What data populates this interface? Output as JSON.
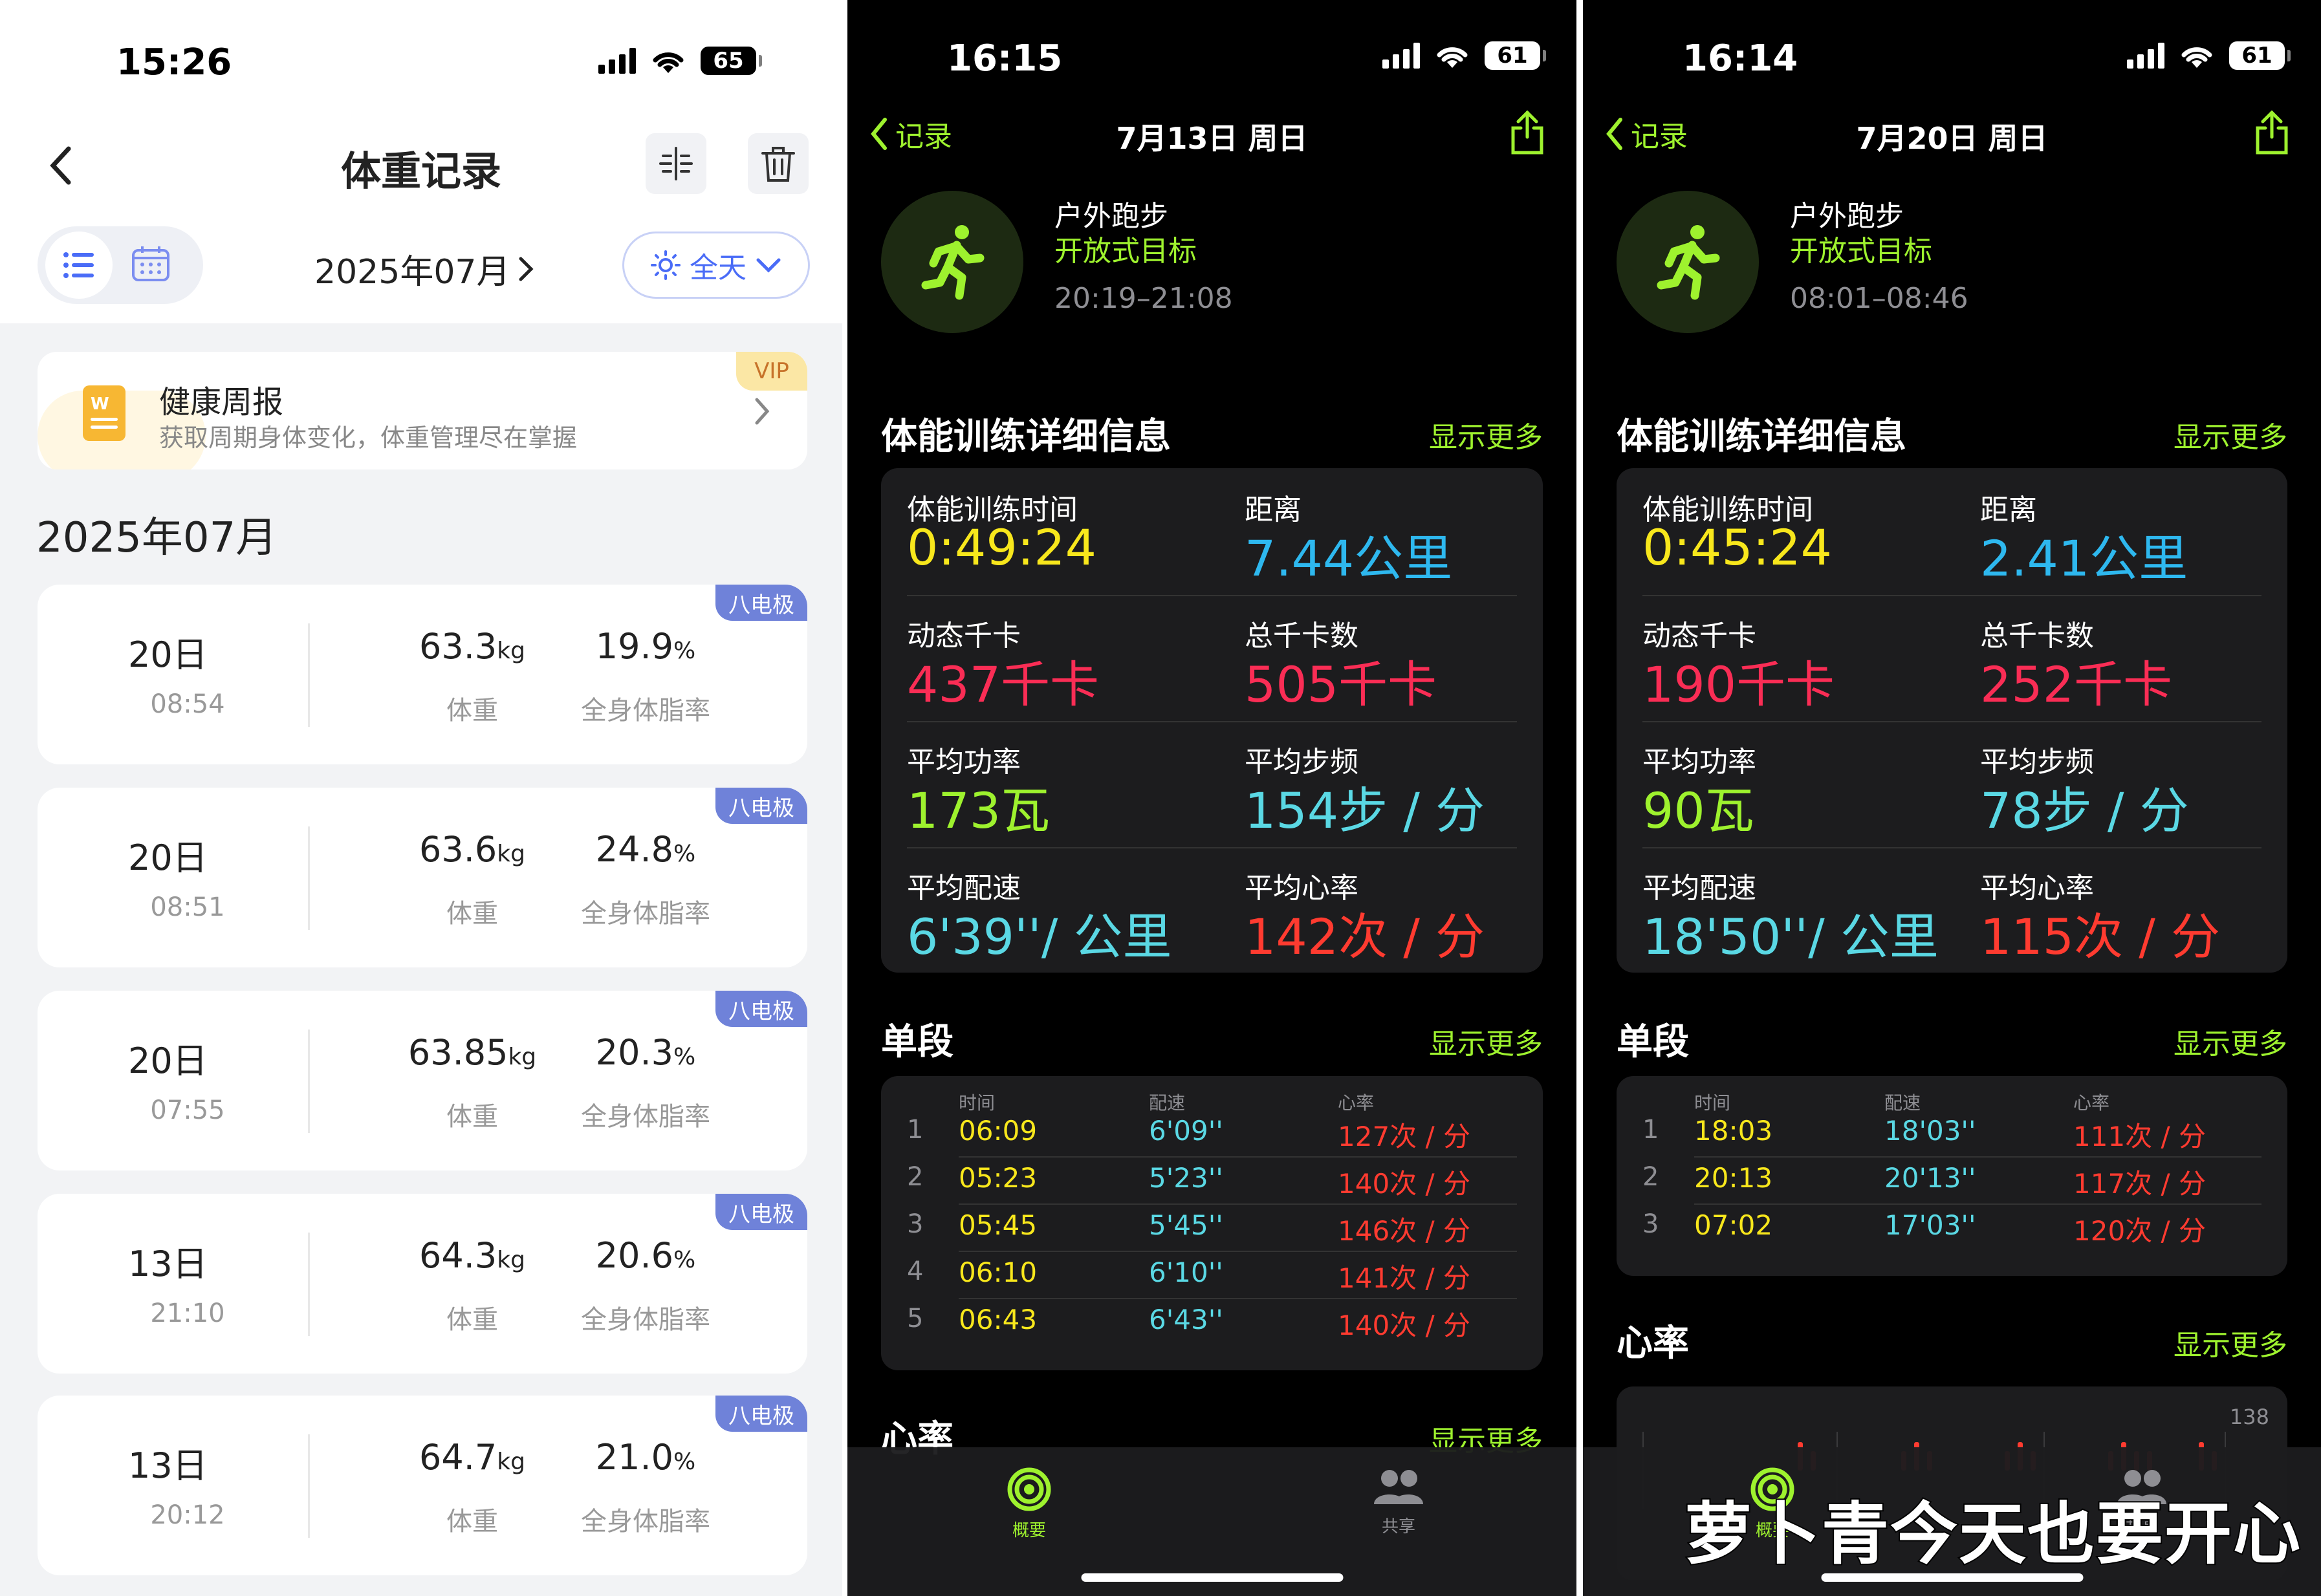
{
  "weight_app": {
    "status_time": "15:26",
    "battery": "65",
    "title": "体重记录",
    "month_selector": "2025年07月",
    "filter": "全天",
    "banner": {
      "title": "健康周报",
      "subtitle": "获取周期身体变化，体重管理尽在掌握",
      "badge": "VIP"
    },
    "section_title": "2025年07月",
    "records": [
      {
        "tag": "八电极",
        "day": "20日",
        "time": "08:54",
        "weight": "63.3",
        "weight_unit": "kg",
        "weight_label": "体重",
        "fat": "19.9",
        "fat_unit": "%",
        "fat_label": "全身体脂率"
      },
      {
        "tag": "八电极",
        "day": "20日",
        "time": "08:51",
        "weight": "63.6",
        "weight_unit": "kg",
        "weight_label": "体重",
        "fat": "24.8",
        "fat_unit": "%",
        "fat_label": "全身体脂率"
      },
      {
        "tag": "八电极",
        "day": "20日",
        "time": "07:55",
        "weight": "63.85",
        "weight_unit": "kg",
        "weight_label": "体重",
        "fat": "20.3",
        "fat_unit": "%",
        "fat_label": "全身体脂率"
      },
      {
        "tag": "八电极",
        "day": "13日",
        "time": "21:10",
        "weight": "64.3",
        "weight_unit": "kg",
        "weight_label": "体重",
        "fat": "20.6",
        "fat_unit": "%",
        "fat_label": "全身体脂率"
      },
      {
        "tag": "八电极",
        "day": "13日",
        "time": "20:12",
        "weight": "64.7",
        "weight_unit": "kg",
        "weight_label": "体重",
        "fat": "21.0",
        "fat_unit": "%",
        "fat_label": "全身体脂率"
      }
    ]
  },
  "workout_a": {
    "status_time": "16:15",
    "battery": "61",
    "back": "记录",
    "date": "7月13日 周日",
    "type": "户外跑步",
    "goal": "开放式目标",
    "time_range": "20:19–21:08",
    "details_title": "体能训练详细信息",
    "show_more": "显示更多",
    "metrics": {
      "duration_label": "体能训练时间",
      "duration": "0:49:24",
      "distance_label": "距离",
      "distance": "7.44",
      "distance_unit": "公里",
      "active_label": "动态千卡",
      "active": "437",
      "active_unit": "千卡",
      "total_label": "总千卡数",
      "total": "505",
      "total_unit": "千卡",
      "power_label": "平均功率",
      "power": "173",
      "power_unit": "瓦",
      "cadence_label": "平均步频",
      "cadence": "154",
      "cadence_unit": "步 / 分",
      "pace_label": "平均配速",
      "pace": "6'39''",
      "pace_unit": "/ 公里",
      "hr_label": "平均心率",
      "hr": "142",
      "hr_unit": "次 / 分"
    },
    "splits_title": "单段",
    "splits_more": "显示更多",
    "split_headers": {
      "time": "时间",
      "pace": "配速",
      "hr": "心率"
    },
    "splits": [
      {
        "n": "1",
        "time": "06:09",
        "pace": "6'09''",
        "hr": "127次 / 分"
      },
      {
        "n": "2",
        "time": "05:23",
        "pace": "5'23''",
        "hr": "140次 / 分"
      },
      {
        "n": "3",
        "time": "05:45",
        "pace": "5'45''",
        "hr": "146次 / 分"
      },
      {
        "n": "4",
        "time": "06:10",
        "pace": "6'10''",
        "hr": "141次 / 分"
      },
      {
        "n": "5",
        "time": "06:43",
        "pace": "6'43''",
        "hr": "140次 / 分"
      }
    ],
    "hr_title": "心率",
    "hr_more": "显示更多",
    "tabs": {
      "summary": "概要",
      "sharing": "共享"
    }
  },
  "workout_b": {
    "status_time": "16:14",
    "battery": "61",
    "back": "记录",
    "date": "7月20日 周日",
    "type": "户外跑步",
    "goal": "开放式目标",
    "time_range": "08:01–08:46",
    "details_title": "体能训练详细信息",
    "show_more": "显示更多",
    "metrics": {
      "duration_label": "体能训练时间",
      "duration": "0:45:24",
      "distance_label": "距离",
      "distance": "2.41",
      "distance_unit": "公里",
      "active_label": "动态千卡",
      "active": "190",
      "active_unit": "千卡",
      "total_label": "总千卡数",
      "total": "252",
      "total_unit": "千卡",
      "power_label": "平均功率",
      "power": "90",
      "power_unit": "瓦",
      "cadence_label": "平均步频",
      "cadence": "78",
      "cadence_unit": "步 / 分",
      "pace_label": "平均配速",
      "pace": "18'50''",
      "pace_unit": "/ 公里",
      "hr_label": "平均心率",
      "hr": "115",
      "hr_unit": "次 / 分"
    },
    "splits_title": "单段",
    "splits_more": "显示更多",
    "split_headers": {
      "time": "时间",
      "pace": "配速",
      "hr": "心率"
    },
    "splits": [
      {
        "n": "1",
        "time": "18:03",
        "pace": "18'03''",
        "hr": "111次 / 分"
      },
      {
        "n": "2",
        "time": "20:13",
        "pace": "20'13''",
        "hr": "117次 / 分"
      },
      {
        "n": "3",
        "time": "07:02",
        "pace": "17'03''",
        "hr": "120次 / 分"
      }
    ],
    "hr_title": "心率",
    "hr_more": "显示更多",
    "hr_chart_max": "138",
    "tabs": {
      "summary": "概要",
      "sharing": "共享"
    },
    "watermark": "萝卜青今天也要开心"
  },
  "colors": {
    "accent_green": "#9ef22e",
    "tag_blue": "#6f82d9",
    "yellow": "#f8e71c",
    "blue": "#2eb8ef",
    "red": "#fa2d55",
    "cyan": "#5ad8e4",
    "orange": "#ff3b30"
  }
}
